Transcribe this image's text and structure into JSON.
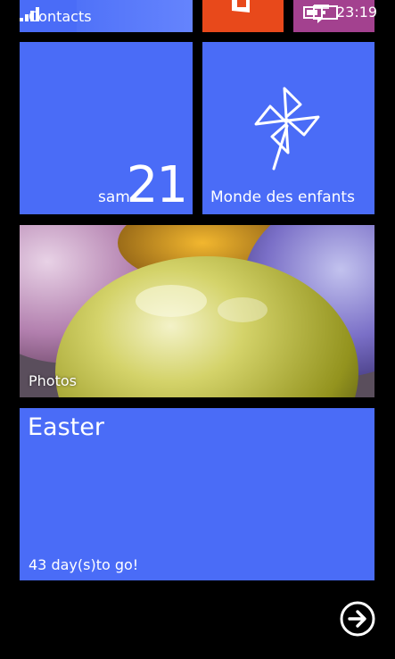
{
  "status_bar": {
    "time": "23:19",
    "signal_icon": "signal-bars-icon",
    "battery_icon": "battery-icon"
  },
  "tiles": {
    "contacts": {
      "label": "Contacts",
      "color": "#4a6cf7"
    },
    "office": {
      "icon": "office-icon",
      "color": "#e8491b"
    },
    "messaging": {
      "icon": "messaging-icon",
      "color": "#a3418f"
    },
    "calendar": {
      "weekday": "sam.",
      "day": "21",
      "color": "#4a6cf7"
    },
    "kids_corner": {
      "label": "Monde des enfants",
      "icon": "pinwheel-icon",
      "color": "#4a6cf7"
    },
    "photos": {
      "label": "Photos"
    },
    "easter": {
      "title": "Easter",
      "countdown": "43 day(s)to go!",
      "color": "#4a6cf7"
    }
  },
  "navigation": {
    "all_apps_icon": "arrow-right-circle-icon"
  }
}
